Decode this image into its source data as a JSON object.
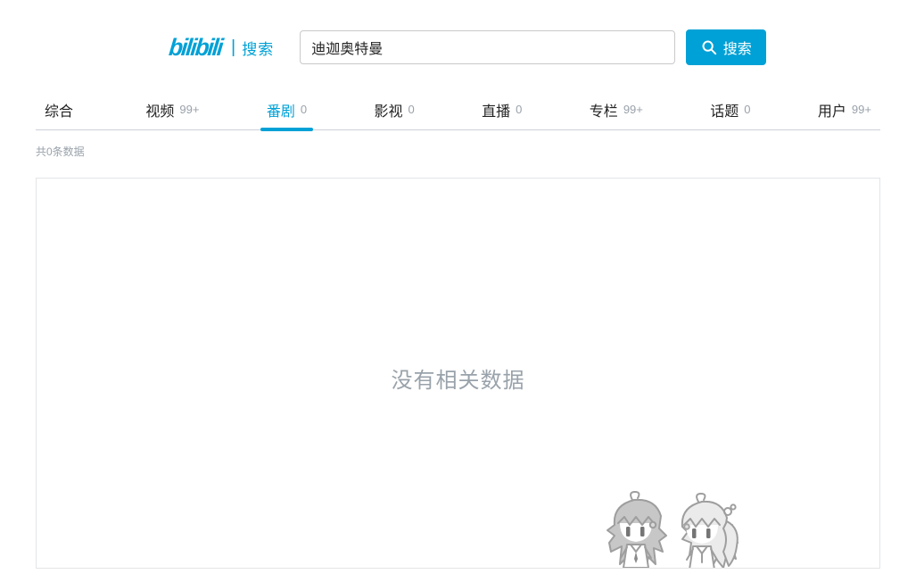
{
  "header": {
    "logo_text": "bilibili",
    "logo_separator": "|",
    "logo_suffix": "搜索",
    "search_value": "迪迦奥特曼",
    "search_button_label": "搜索"
  },
  "tabs": [
    {
      "label": "综合",
      "count": ""
    },
    {
      "label": "视频",
      "count": "99+"
    },
    {
      "label": "番剧",
      "count": "0",
      "active": true
    },
    {
      "label": "影视",
      "count": "0"
    },
    {
      "label": "直播",
      "count": "0"
    },
    {
      "label": "专栏",
      "count": "99+"
    },
    {
      "label": "话题",
      "count": "0"
    },
    {
      "label": "用户",
      "count": "99+"
    }
  ],
  "result_summary": "共0条数据",
  "empty_state": {
    "message": "没有相关数据",
    "mascot": "bilibili-2233-mascot-illustration"
  },
  "colors": {
    "brand_blue": "#00a1d6",
    "tab_text": "#222222",
    "muted_grey": "#99a2aa",
    "tabbar_border": "#ccd0d7",
    "box_border": "#e3e5e7"
  }
}
